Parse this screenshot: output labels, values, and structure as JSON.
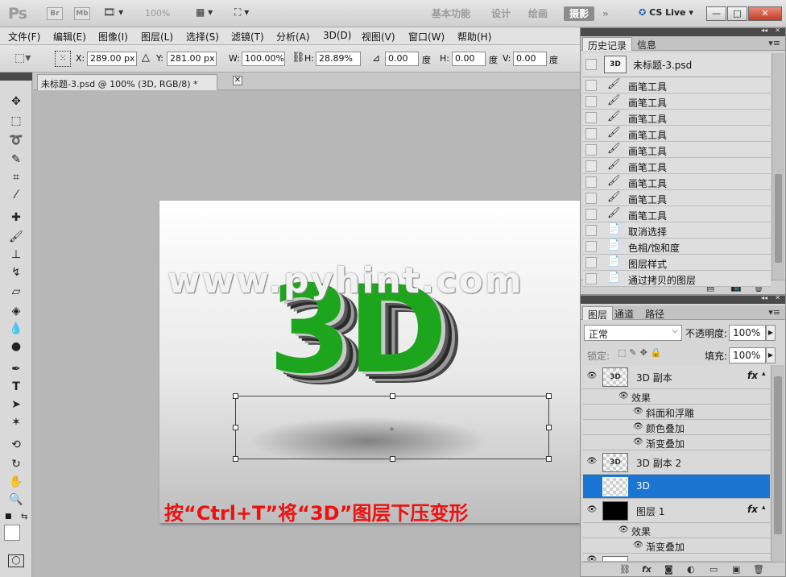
{
  "appbar": {
    "logo": "Ps",
    "bridge": "Br",
    "minibridge": "Mb",
    "zoom": "100%",
    "workspaces": [
      "基本功能",
      "设计",
      "绘画",
      "摄影"
    ],
    "more": "»",
    "cs_live": "CS Live",
    "window_buttons": [
      "—",
      "□",
      "✕"
    ]
  },
  "menubar": {
    "items": [
      "文件(F)",
      "编辑(E)",
      "图像(I)",
      "图层(L)",
      "选择(S)",
      "滤镜(T)",
      "分析(A)",
      "3D(D)",
      "视图(V)",
      "窗口(W)",
      "帮助(H)"
    ]
  },
  "options": {
    "x_label": "X:",
    "x_value": "289.00 px",
    "y_label": "Y:",
    "y_value": "281.00 px",
    "w_label": "W:",
    "w_value": "100.00%",
    "h_label": "H:",
    "h_value": "28.89%",
    "angle_value": "0.00",
    "angle_unit": "度",
    "hskew_label": "H:",
    "hskew_value": "0.00",
    "hskew_unit": "度",
    "vskew_label": "V:",
    "vskew_value": "0.00",
    "vskew_unit": "度"
  },
  "document": {
    "tab_title": "未标题-3.psd @ 100% (3D, RGB/8) *",
    "close": "✕"
  },
  "canvas": {
    "art_text": "3D",
    "watermark": "www.pyhint.com",
    "caption": "按“Ctrl+T”将“3D”图层下压变形",
    "center_mark": "⌖"
  },
  "history": {
    "tabs": [
      "历史记录",
      "信息"
    ],
    "snapshot": {
      "thumb": "3D",
      "label": "未标题-3.psd"
    },
    "items": [
      {
        "icon": "brush-icon",
        "label": "画笔工具"
      },
      {
        "icon": "brush-icon",
        "label": "画笔工具"
      },
      {
        "icon": "brush-icon",
        "label": "画笔工具"
      },
      {
        "icon": "brush-icon",
        "label": "画笔工具"
      },
      {
        "icon": "brush-icon",
        "label": "画笔工具"
      },
      {
        "icon": "brush-icon",
        "label": "画笔工具"
      },
      {
        "icon": "brush-icon",
        "label": "画笔工具"
      },
      {
        "icon": "brush-icon",
        "label": "画笔工具"
      },
      {
        "icon": "brush-icon",
        "label": "画笔工具"
      },
      {
        "icon": "document-icon",
        "label": "取消选择"
      },
      {
        "icon": "document-icon",
        "label": "色相/饱和度"
      },
      {
        "icon": "document-icon",
        "label": "图层样式"
      },
      {
        "icon": "document-icon",
        "label": "通过拷贝的图层"
      }
    ]
  },
  "layers": {
    "tabs": [
      "图层",
      "通道",
      "路径"
    ],
    "blend_mode": "正常",
    "opacity_label": "不透明度:",
    "opacity_value": "100%",
    "lock_label": "锁定:",
    "fill_label": "填充:",
    "fill_value": "100%",
    "rows": [
      {
        "name": "3D 副本",
        "thumb": "3D",
        "fx": "fx"
      },
      {
        "name": "3D 副本 2",
        "thumb": "3D"
      },
      {
        "name": "3D",
        "thumb": ""
      },
      {
        "name": "图层 1",
        "thumb": "",
        "fx": "fx"
      }
    ],
    "effects_label": "效果",
    "effects_a": [
      "斜面和浮雕",
      "颜色叠加",
      "渐变叠加"
    ],
    "effects_b": [
      "渐变叠加"
    ]
  },
  "colors": {
    "accent_selection": "#1a76d2",
    "caption_red": "#ee1111",
    "art_green": "#1ea51e"
  }
}
